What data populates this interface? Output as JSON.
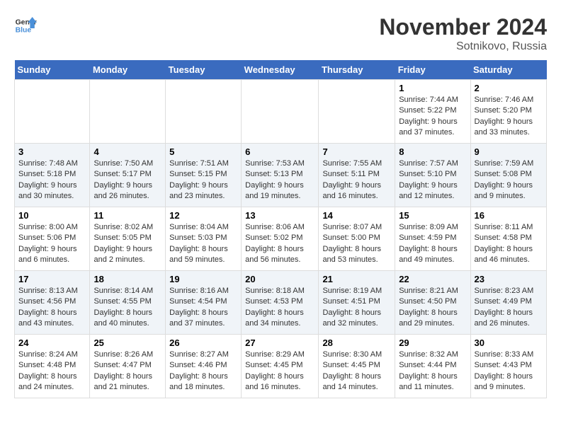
{
  "header": {
    "logo_line1": "General",
    "logo_line2": "Blue",
    "month": "November 2024",
    "location": "Sotnikovo, Russia"
  },
  "weekdays": [
    "Sunday",
    "Monday",
    "Tuesday",
    "Wednesday",
    "Thursday",
    "Friday",
    "Saturday"
  ],
  "weeks": [
    [
      {
        "day": "",
        "info": ""
      },
      {
        "day": "",
        "info": ""
      },
      {
        "day": "",
        "info": ""
      },
      {
        "day": "",
        "info": ""
      },
      {
        "day": "",
        "info": ""
      },
      {
        "day": "1",
        "info": "Sunrise: 7:44 AM\nSunset: 5:22 PM\nDaylight: 9 hours\nand 37 minutes."
      },
      {
        "day": "2",
        "info": "Sunrise: 7:46 AM\nSunset: 5:20 PM\nDaylight: 9 hours\nand 33 minutes."
      }
    ],
    [
      {
        "day": "3",
        "info": "Sunrise: 7:48 AM\nSunset: 5:18 PM\nDaylight: 9 hours\nand 30 minutes."
      },
      {
        "day": "4",
        "info": "Sunrise: 7:50 AM\nSunset: 5:17 PM\nDaylight: 9 hours\nand 26 minutes."
      },
      {
        "day": "5",
        "info": "Sunrise: 7:51 AM\nSunset: 5:15 PM\nDaylight: 9 hours\nand 23 minutes."
      },
      {
        "day": "6",
        "info": "Sunrise: 7:53 AM\nSunset: 5:13 PM\nDaylight: 9 hours\nand 19 minutes."
      },
      {
        "day": "7",
        "info": "Sunrise: 7:55 AM\nSunset: 5:11 PM\nDaylight: 9 hours\nand 16 minutes."
      },
      {
        "day": "8",
        "info": "Sunrise: 7:57 AM\nSunset: 5:10 PM\nDaylight: 9 hours\nand 12 minutes."
      },
      {
        "day": "9",
        "info": "Sunrise: 7:59 AM\nSunset: 5:08 PM\nDaylight: 9 hours\nand 9 minutes."
      }
    ],
    [
      {
        "day": "10",
        "info": "Sunrise: 8:00 AM\nSunset: 5:06 PM\nDaylight: 9 hours\nand 6 minutes."
      },
      {
        "day": "11",
        "info": "Sunrise: 8:02 AM\nSunset: 5:05 PM\nDaylight: 9 hours\nand 2 minutes."
      },
      {
        "day": "12",
        "info": "Sunrise: 8:04 AM\nSunset: 5:03 PM\nDaylight: 8 hours\nand 59 minutes."
      },
      {
        "day": "13",
        "info": "Sunrise: 8:06 AM\nSunset: 5:02 PM\nDaylight: 8 hours\nand 56 minutes."
      },
      {
        "day": "14",
        "info": "Sunrise: 8:07 AM\nSunset: 5:00 PM\nDaylight: 8 hours\nand 53 minutes."
      },
      {
        "day": "15",
        "info": "Sunrise: 8:09 AM\nSunset: 4:59 PM\nDaylight: 8 hours\nand 49 minutes."
      },
      {
        "day": "16",
        "info": "Sunrise: 8:11 AM\nSunset: 4:58 PM\nDaylight: 8 hours\nand 46 minutes."
      }
    ],
    [
      {
        "day": "17",
        "info": "Sunrise: 8:13 AM\nSunset: 4:56 PM\nDaylight: 8 hours\nand 43 minutes."
      },
      {
        "day": "18",
        "info": "Sunrise: 8:14 AM\nSunset: 4:55 PM\nDaylight: 8 hours\nand 40 minutes."
      },
      {
        "day": "19",
        "info": "Sunrise: 8:16 AM\nSunset: 4:54 PM\nDaylight: 8 hours\nand 37 minutes."
      },
      {
        "day": "20",
        "info": "Sunrise: 8:18 AM\nSunset: 4:53 PM\nDaylight: 8 hours\nand 34 minutes."
      },
      {
        "day": "21",
        "info": "Sunrise: 8:19 AM\nSunset: 4:51 PM\nDaylight: 8 hours\nand 32 minutes."
      },
      {
        "day": "22",
        "info": "Sunrise: 8:21 AM\nSunset: 4:50 PM\nDaylight: 8 hours\nand 29 minutes."
      },
      {
        "day": "23",
        "info": "Sunrise: 8:23 AM\nSunset: 4:49 PM\nDaylight: 8 hours\nand 26 minutes."
      }
    ],
    [
      {
        "day": "24",
        "info": "Sunrise: 8:24 AM\nSunset: 4:48 PM\nDaylight: 8 hours\nand 24 minutes."
      },
      {
        "day": "25",
        "info": "Sunrise: 8:26 AM\nSunset: 4:47 PM\nDaylight: 8 hours\nand 21 minutes."
      },
      {
        "day": "26",
        "info": "Sunrise: 8:27 AM\nSunset: 4:46 PM\nDaylight: 8 hours\nand 18 minutes."
      },
      {
        "day": "27",
        "info": "Sunrise: 8:29 AM\nSunset: 4:45 PM\nDaylight: 8 hours\nand 16 minutes."
      },
      {
        "day": "28",
        "info": "Sunrise: 8:30 AM\nSunset: 4:45 PM\nDaylight: 8 hours\nand 14 minutes."
      },
      {
        "day": "29",
        "info": "Sunrise: 8:32 AM\nSunset: 4:44 PM\nDaylight: 8 hours\nand 11 minutes."
      },
      {
        "day": "30",
        "info": "Sunrise: 8:33 AM\nSunset: 4:43 PM\nDaylight: 8 hours\nand 9 minutes."
      }
    ]
  ]
}
